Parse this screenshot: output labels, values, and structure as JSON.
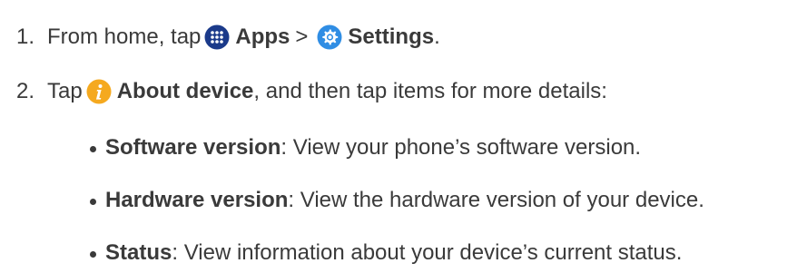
{
  "steps": [
    {
      "number": "1.",
      "text_before": "From home, tap",
      "icon1": "apps-grid-icon",
      "label1": "Apps",
      "separator": ">",
      "icon2": "settings-gear-icon",
      "label2": "Settings",
      "text_after": "."
    },
    {
      "number": "2.",
      "text_before": "Tap",
      "icon1": "info-icon",
      "label1": "About device",
      "text_after": ", and then tap items for more details:"
    }
  ],
  "bullets": [
    {
      "label": "Software version",
      "text": ": View your phone’s software version."
    },
    {
      "label": "Hardware version",
      "text": ": View the hardware version of your device."
    },
    {
      "label": "Status",
      "text": ": View information about your device’s current status."
    }
  ],
  "colors": {
    "text": "#3a3a3a",
    "apps_icon_bg": "#1b3a8a",
    "settings_icon_bg": "#2f8de4",
    "info_icon_bg": "#f5a91f"
  }
}
